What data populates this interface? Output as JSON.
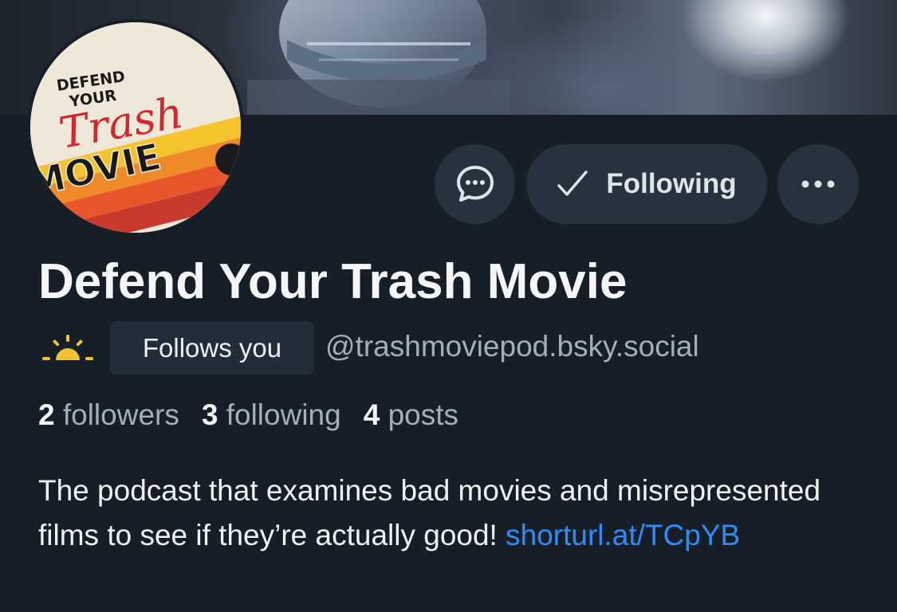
{
  "profile": {
    "display_name": "Defend Your Trash Movie",
    "handle": "@trashmoviepod.bsky.social",
    "follows_you_label": "Follows you",
    "badge_icon": "sun-icon",
    "bio_text": "The podcast that examines bad movies and misrepresented films to see if they’re actually good! ",
    "bio_link": "shorturl.at/TCpYB",
    "avatar_text": {
      "line1": "DEFEND",
      "line2": "YOUR",
      "line3": "Trash",
      "line4": "MOVIE"
    }
  },
  "actions": {
    "message_icon": "message-bubble-icon",
    "following_label": "Following",
    "following_icon": "checkmark-icon",
    "more_icon": "ellipsis-icon"
  },
  "stats": {
    "followers_count": "2",
    "followers_label": "followers",
    "following_count": "3",
    "following_label": "following",
    "posts_count": "4",
    "posts_label": "posts"
  },
  "colors": {
    "background": "#161e27",
    "button_bg": "#27323f",
    "link": "#2f8cf7",
    "muted_text": "#a4afbb",
    "sun_icon": "#f2c230"
  }
}
